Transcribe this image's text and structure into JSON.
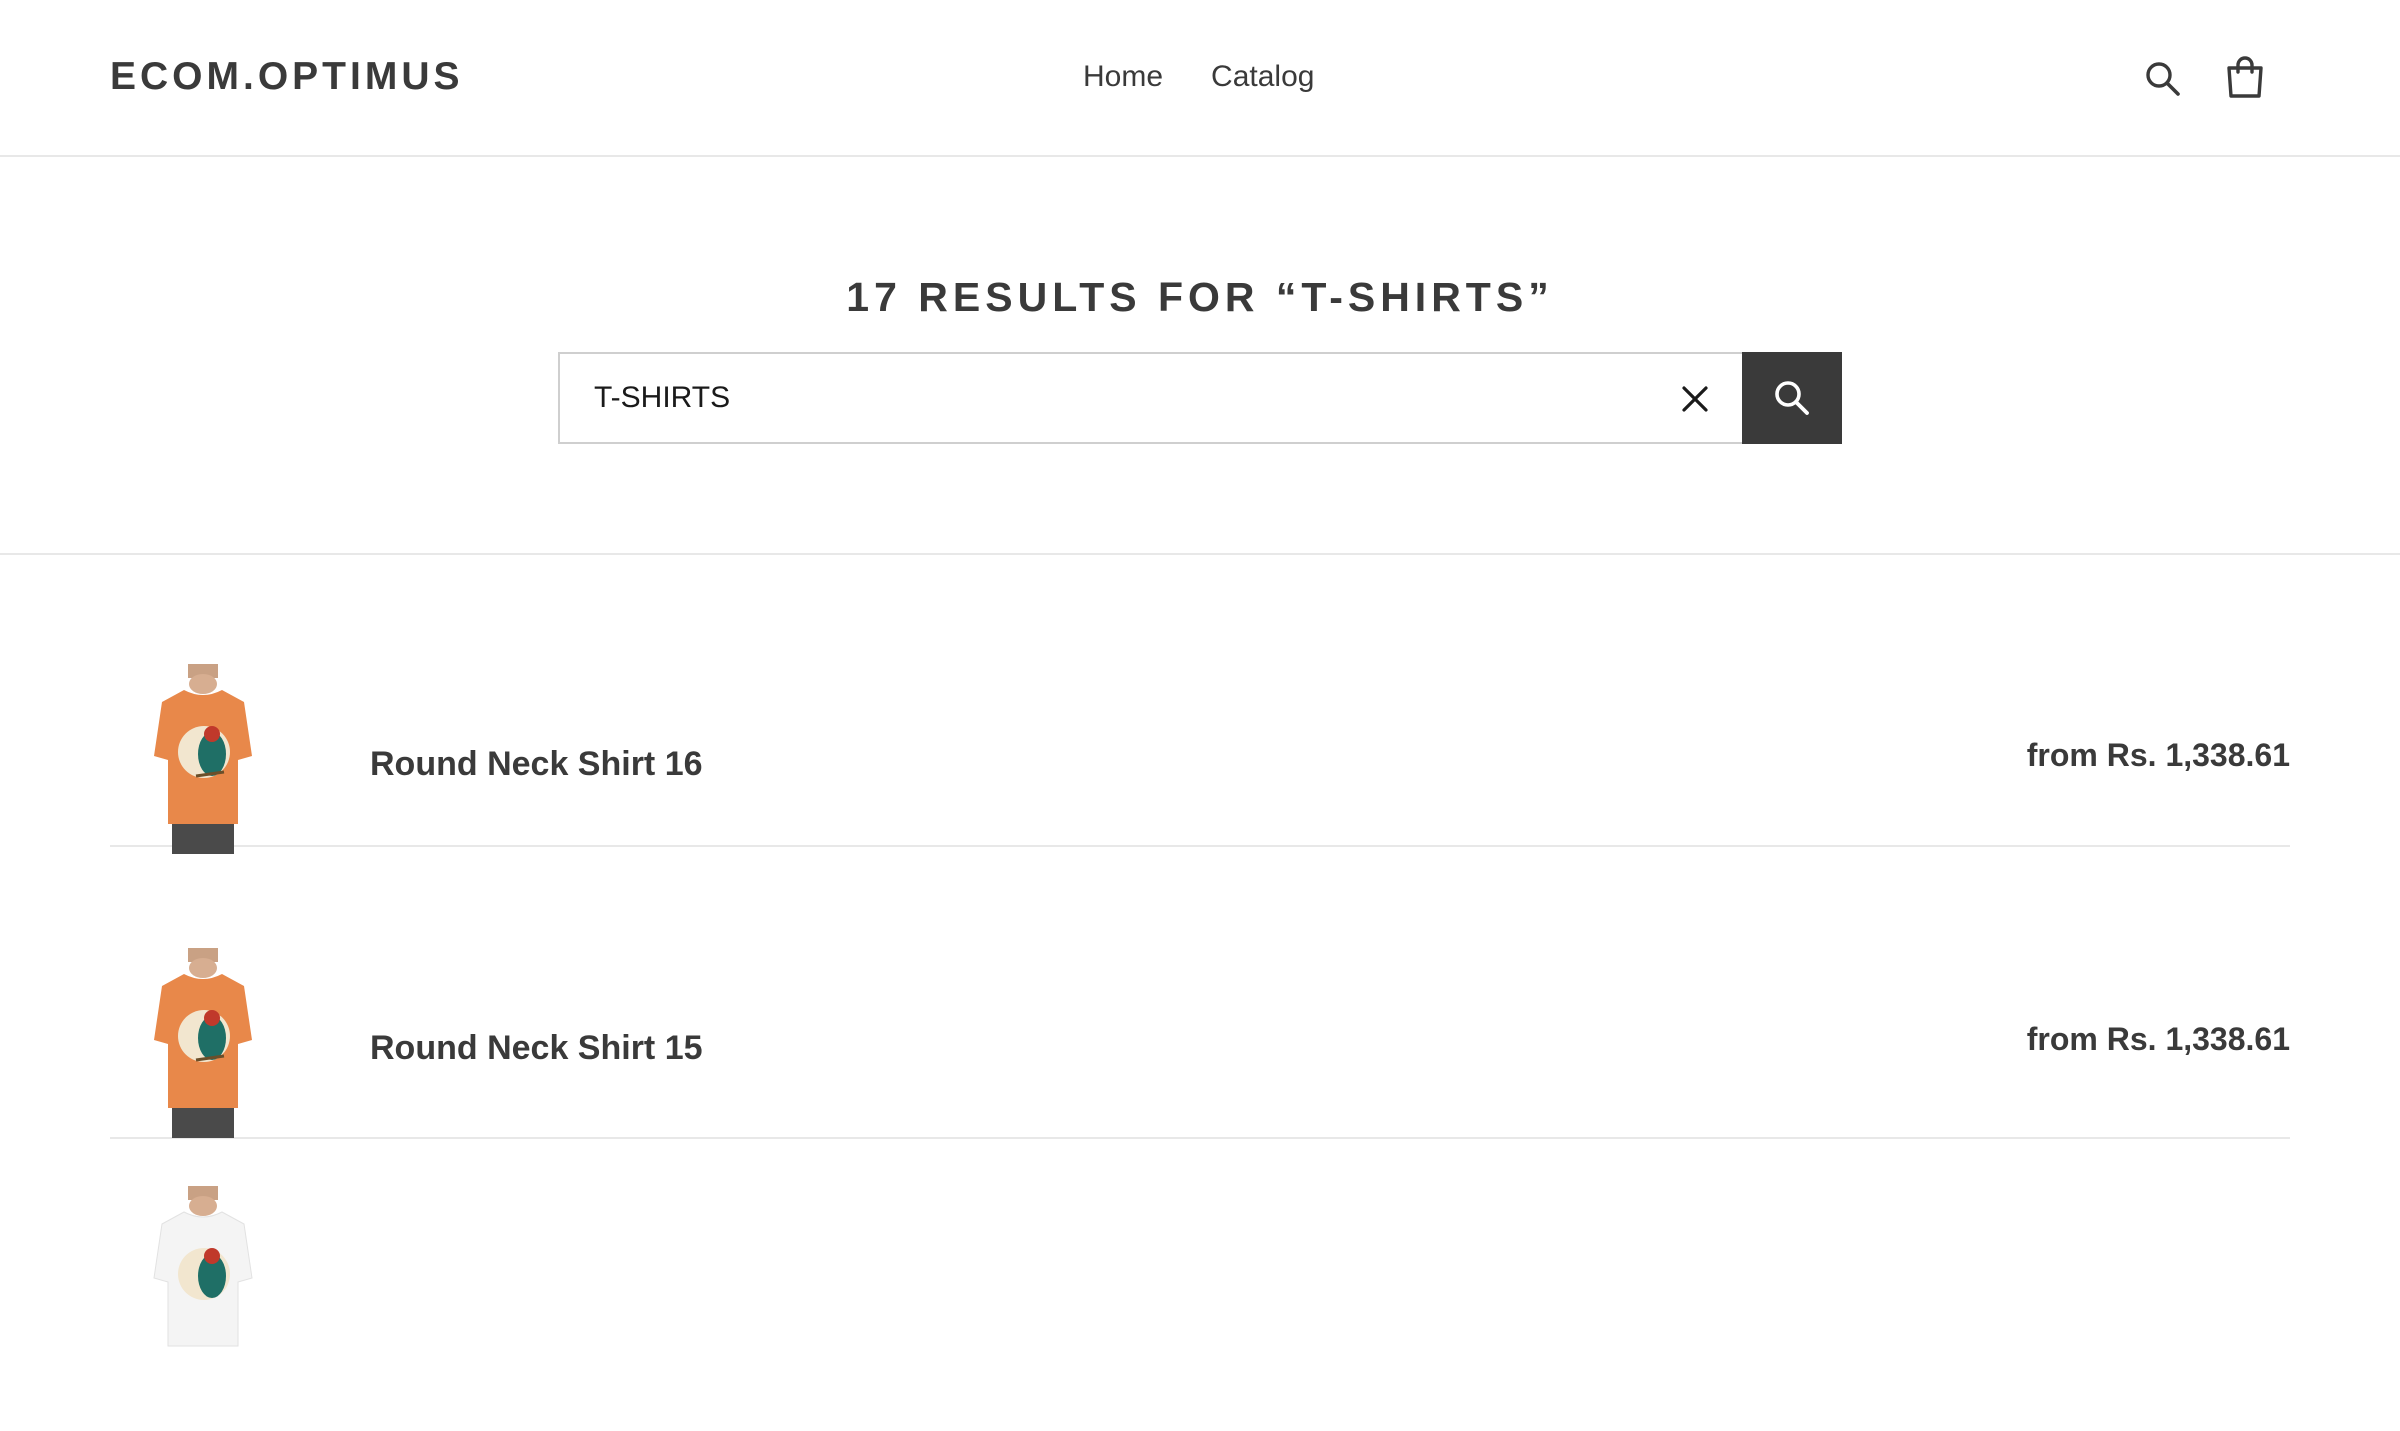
{
  "header": {
    "logo": "ECOM.OPTIMUS",
    "nav": [
      {
        "label": "Home"
      },
      {
        "label": "Catalog"
      }
    ],
    "icons": [
      "search-icon",
      "cart-icon"
    ]
  },
  "search": {
    "title": "17 RESULTS FOR “T-SHIRTS”",
    "query": "T-SHIRTS",
    "icons": [
      "clear-icon",
      "search-icon"
    ]
  },
  "results": [
    {
      "title": "Round Neck Shirt 16",
      "price": "from Rs. 1,338.61",
      "shirt_color": "#e8884a"
    },
    {
      "title": "Round Neck Shirt 15",
      "price": "from Rs. 1,338.61",
      "shirt_color": "#e8884a"
    },
    {
      "title": "",
      "price": "",
      "shirt_color": "#f4f4f4"
    }
  ],
  "colors": {
    "text": "#3a3a3a",
    "button": "#3a3a3a",
    "border": "#e8e8e8"
  }
}
